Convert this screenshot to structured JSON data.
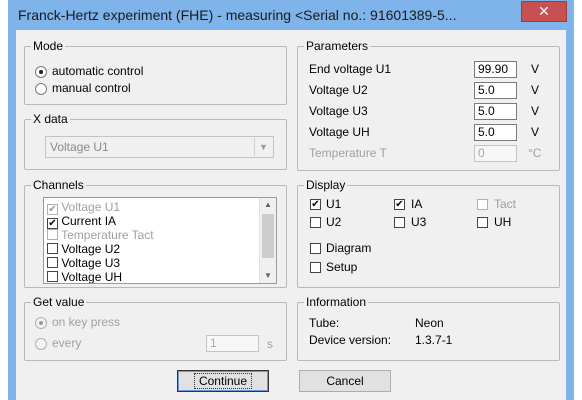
{
  "window": {
    "title": "Franck-Hertz experiment (FHE) - measuring  <Serial no.: 91601389-5...",
    "close_symbol": "✕"
  },
  "mode": {
    "legend": "Mode",
    "options": [
      {
        "label": "automatic control",
        "selected": true
      },
      {
        "label": "manual control",
        "selected": false
      }
    ]
  },
  "xdata": {
    "legend": "X data",
    "value": "Voltage U1",
    "arrow": "▼"
  },
  "channels": {
    "legend": "Channels",
    "items": [
      {
        "label": "Voltage U1",
        "checked": true,
        "enabled": false
      },
      {
        "label": "Current IA",
        "checked": true,
        "enabled": true
      },
      {
        "label": "Temperature Tact",
        "checked": false,
        "enabled": false
      },
      {
        "label": "Voltage U2",
        "checked": false,
        "enabled": true
      },
      {
        "label": "Voltage U3",
        "checked": false,
        "enabled": true
      },
      {
        "label": "Voltage UH",
        "checked": false,
        "enabled": true
      }
    ],
    "scroll_up": "▲",
    "scroll_down": "▼"
  },
  "getvalue": {
    "legend": "Get value",
    "on_key_press": "on key press",
    "every": "every",
    "interval": "1",
    "unit": "s"
  },
  "parameters": {
    "legend": "Parameters",
    "rows": [
      {
        "label": "End voltage U1",
        "value": "99.90",
        "unit": "V"
      },
      {
        "label": "Voltage U2",
        "value": "5.0",
        "unit": "V"
      },
      {
        "label": "Voltage U3",
        "value": "5.0",
        "unit": "V"
      },
      {
        "label": "Voltage UH",
        "value": "5.0",
        "unit": "V"
      },
      {
        "label": "Temperature T",
        "value": "0",
        "unit": "°C"
      }
    ]
  },
  "display": {
    "legend": "Display",
    "u1": "U1",
    "ia": "IA",
    "tact": "Tact",
    "u2": "U2",
    "u3": "U3",
    "uh": "UH",
    "diagram": "Diagram",
    "setup": "Setup"
  },
  "information": {
    "legend": "Information",
    "tube_label": "Tube:",
    "tube_value": "Neon",
    "version_label": "Device version:",
    "version_value": "1.3.7-1"
  },
  "buttons": {
    "continue": "Continue",
    "cancel": "Cancel"
  }
}
